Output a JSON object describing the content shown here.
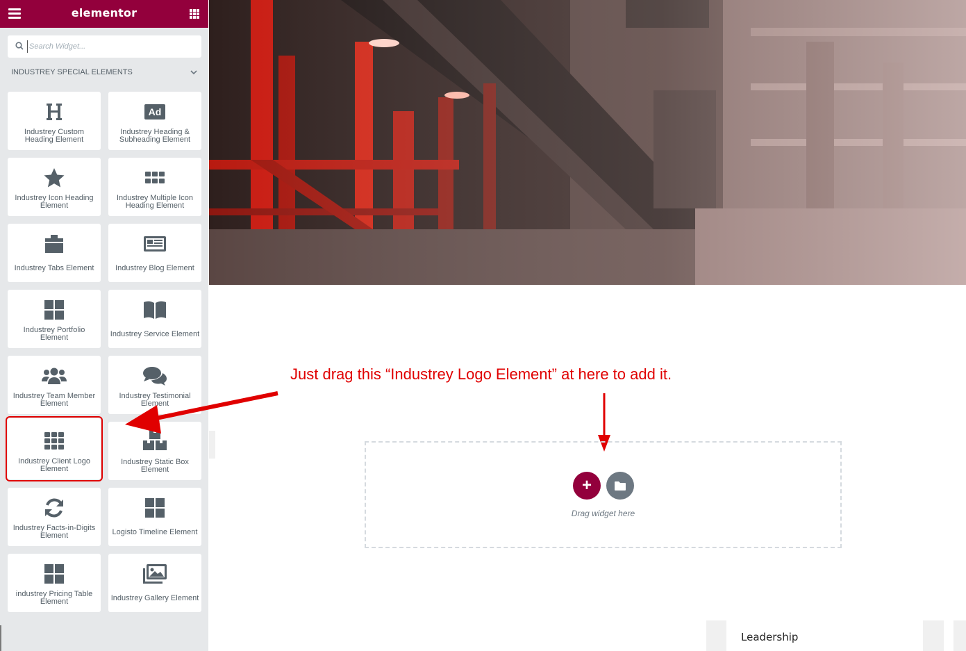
{
  "app": {
    "brand": "elementor"
  },
  "search": {
    "placeholder": "Search Widget..."
  },
  "category": {
    "label": "INDUSTREY SPECIAL ELEMENTS"
  },
  "widgets": [
    {
      "label": "Industrey Custom Heading Element",
      "icon": "heading-icon"
    },
    {
      "label": "Industrey Heading & Subheading Element",
      "icon": "ad-icon"
    },
    {
      "label": "Industrey Icon Heading Element",
      "icon": "star-icon"
    },
    {
      "label": "Industrey Multiple Icon Heading Element",
      "icon": "dots-grid-icon"
    },
    {
      "label": "Industrey Tabs Element",
      "icon": "tabs-icon"
    },
    {
      "label": "Industrey Blog Element",
      "icon": "newspaper-icon"
    },
    {
      "label": "Industrey Portfolio Element",
      "icon": "four-squares-icon"
    },
    {
      "label": "Industrey Service Element",
      "icon": "book-icon"
    },
    {
      "label": "Industrey Team Member Element",
      "icon": "users-icon"
    },
    {
      "label": "Industrey Testimonial Element",
      "icon": "comments-icon"
    },
    {
      "label": "Industrey Client Logo Element",
      "icon": "nine-dots-grid-icon"
    },
    {
      "label": "Industrey Static Box Element",
      "icon": "boxes-icon"
    },
    {
      "label": "Industrey Facts-in-Digits Element",
      "icon": "sync-icon"
    },
    {
      "label": "Logisto Timeline Element",
      "icon": "four-squares-icon"
    },
    {
      "label": "industrey Pricing Table Element",
      "icon": "four-squares-icon"
    },
    {
      "label": "Industrey Gallery Element",
      "icon": "images-icon"
    }
  ],
  "annotation": {
    "text": "Just drag this “Industrey Logo Element” at here to add it."
  },
  "dropzone": {
    "hint": "Drag widget here",
    "add_symbol": "+"
  },
  "footer": {
    "leadership": "Leadership"
  },
  "colors": {
    "brand": "#93003c",
    "annotation": "#e00000",
    "panel": "#e6e8ea"
  }
}
